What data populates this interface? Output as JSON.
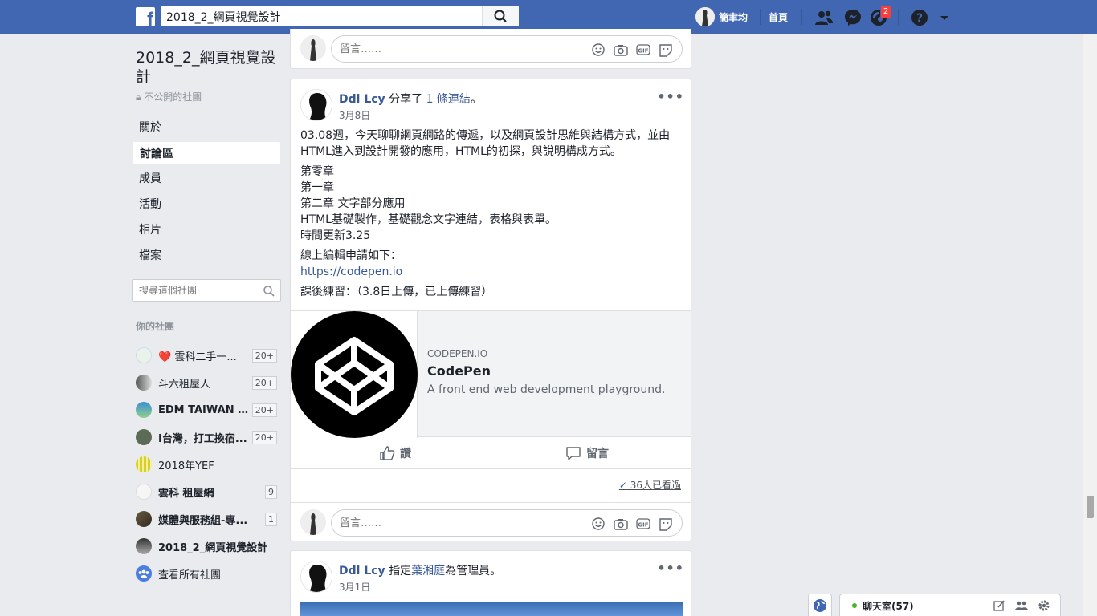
{
  "topbar": {
    "search_value": "2018_2_網頁視覺設計",
    "user_name": "簡聿均",
    "home_label": "首頁",
    "notification_count": "2",
    "brand_color": "#4267b2"
  },
  "group": {
    "title": "2018_2_網頁視覺設計",
    "privacy": "不公開的社團",
    "nav": [
      "關於",
      "討論區",
      "成員",
      "活動",
      "相片",
      "檔案"
    ],
    "active_nav": "討論區",
    "search_placeholder": "搜尋這個社團"
  },
  "your_groups": {
    "label": "你的社團",
    "items": [
      {
        "name": "❤️ 雲科二手一...",
        "count": "20+"
      },
      {
        "name": "斗六租屋人",
        "count": "20+"
      },
      {
        "name": "EDM TAIWAN (...",
        "count": "20+"
      },
      {
        "name": "I台灣，打工換宿...",
        "count": "20+"
      },
      {
        "name": "2018年YEF",
        "count": ""
      },
      {
        "name": "雲科 租屋網",
        "count": "9"
      },
      {
        "name": "媒體與服務組-專...",
        "count": "1"
      },
      {
        "name": "2018_2_網頁視覺設計",
        "count": ""
      },
      {
        "name": "查看所有社團",
        "count": ""
      }
    ]
  },
  "comment": {
    "placeholder": "留言……"
  },
  "post1": {
    "author": "Ddl Lcy",
    "action": "分享了",
    "action_link": "1 條連結",
    "action_end": "。",
    "date": "3月8日",
    "para1": "03.08週，今天聊聊網頁網路的傳遞，以及網頁設計思維與結構方式，並由HTML進入到設計開發的應用，HTML的初探，與說明構成方式。",
    "lines": [
      "第零章",
      "第一章",
      "第二章 文字部分應用",
      "HTML基礎製作，基礎觀念文字連結，表格與表單。",
      "時間更新3.25"
    ],
    "apply_label": "線上編輯申請如下：",
    "apply_link": "https://codepen.io",
    "homework": "課後練習：（3.8日上傳，已上傳練習）",
    "preview": {
      "domain": "CODEPEN.IO",
      "title": "CodePen",
      "desc": "A front end web development playground."
    },
    "like_label": "讚",
    "comment_label": "留言",
    "seen_label": "36人已看過"
  },
  "post2": {
    "author": "Ddl Lcy",
    "action": "指定",
    "action_link": "葉湘庭",
    "action_end": "為管理員。",
    "date": "3月1日"
  },
  "chat": {
    "label": "聊天室(57)"
  }
}
